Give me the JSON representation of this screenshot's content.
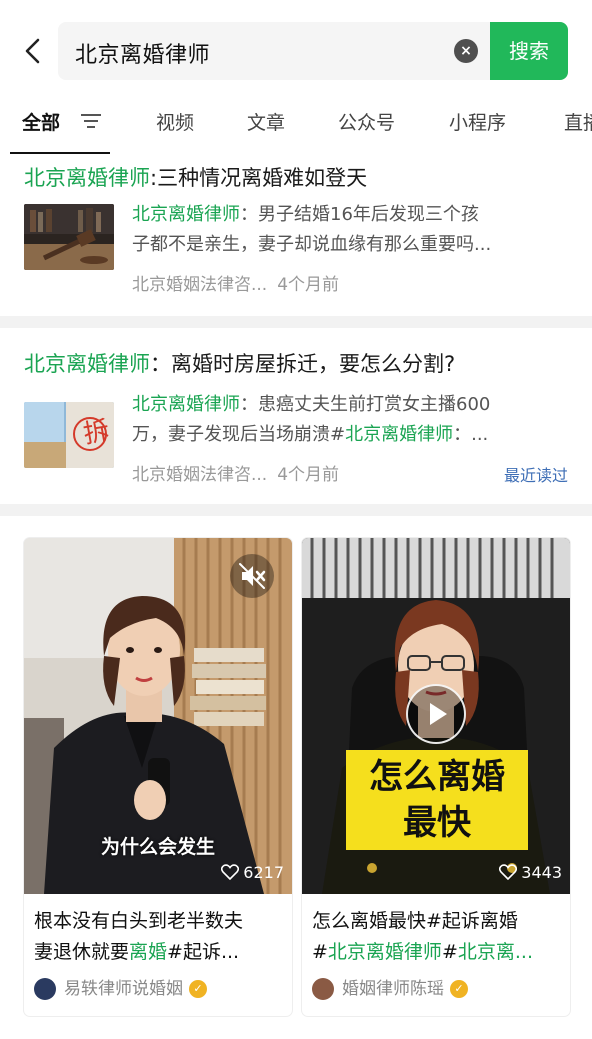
{
  "search": {
    "query": "北京离婚律师",
    "button_label": "搜索"
  },
  "tabs": [
    {
      "label": "全部"
    },
    {
      "label": "视频"
    },
    {
      "label": "文章"
    },
    {
      "label": "公众号"
    },
    {
      "label": "小程序"
    },
    {
      "label": "直播"
    }
  ],
  "results": [
    {
      "title_highlight": "北京离婚律师",
      "title_rest": ":三种情况离婚难如登天",
      "snippet_highlight": "北京离婚律师",
      "snippet_line1_rest": "：男子结婚16年后发现三个孩",
      "snippet_line2": "子都不是亲生，妻子却说血缘有那么重要吗...",
      "source": "北京婚姻法律咨...",
      "time": "4个月前"
    },
    {
      "title_highlight": "北京离婚律师",
      "title_rest": "：离婚时房屋拆迁，要怎么分割?",
      "snippet_highlight": "北京离婚律师",
      "snippet_line1_rest": "：患癌丈夫生前打赏女主播600",
      "snippet_line2_pre": "万，妻子发现后当场崩溃#",
      "snippet_line2_highlight": "北京离婚律师",
      "snippet_line2_post": "：...",
      "source": "北京婚姻法律咨...",
      "time": "4个月前",
      "badge": "最近读过"
    }
  ],
  "videos": [
    {
      "cover_caption": "为什么会发生",
      "likes": "6217",
      "title_line1": "根本没有白头到老半数夫",
      "title_line2_pre": "妻退休就要",
      "title_line2_highlight": "离婚",
      "title_line2_post": "#起诉...",
      "author": "易轶律师说婚姻"
    },
    {
      "cover_text_line1": "怎么离婚",
      "cover_text_line2": "最快",
      "likes": "3443",
      "title_line1": "怎么离婚最快#起诉离婚",
      "title_line2_pre": "#",
      "title_line2_highlight": "北京离婚律师",
      "title_line2_mid": "#",
      "title_line2_highlight2": "北京离...",
      "author": "婚姻律师陈瑶"
    }
  ],
  "colors": {
    "accent": "#21b85a",
    "highlight": "#1aa452",
    "link": "#3f6fb6",
    "verified": "#f0b323"
  }
}
